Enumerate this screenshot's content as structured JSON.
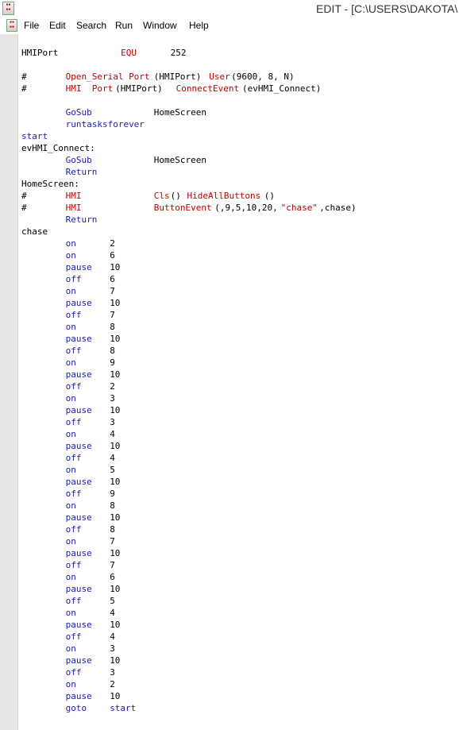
{
  "window": {
    "title": "EDIT - [C:\\USERS\\DAKOTA\\"
  },
  "menu": [
    "File",
    "Edit",
    "Search",
    "Run",
    "Window",
    "Help"
  ],
  "colors": {
    "keyword": "#2020b0",
    "red": "#c00000",
    "plain": "#000000"
  },
  "code_lines": [
    [
      [
        "HMIPort",
        0,
        "plain"
      ],
      [
        "EQU",
        18,
        "red"
      ],
      [
        "252",
        27,
        "plain"
      ]
    ],
    [],
    [
      [
        "#",
        0,
        "plain"
      ],
      [
        "Open_Serial Port",
        8,
        "red"
      ],
      [
        "(HMIPort) ",
        24,
        "plain"
      ],
      [
        "User",
        34,
        "red"
      ],
      [
        "(9600, 8, N)",
        38,
        "plain"
      ]
    ],
    [
      [
        "#",
        0,
        "plain"
      ],
      [
        "HMI  Port",
        8,
        "red"
      ],
      [
        "(HMIPort)  ",
        17,
        "plain"
      ],
      [
        "ConnectEvent",
        28,
        "red"
      ],
      [
        "(evHMI_Connect)",
        40,
        "plain"
      ]
    ],
    [],
    [
      [
        "GoSub",
        8,
        "keyword"
      ],
      [
        "HomeScreen",
        24,
        "plain"
      ]
    ],
    [
      [
        "runtasksforever",
        8,
        "keyword"
      ]
    ],
    [
      [
        "start",
        0,
        "keyword"
      ]
    ],
    [
      [
        "evHMI_Connect:",
        0,
        "plain"
      ]
    ],
    [
      [
        "GoSub",
        8,
        "keyword"
      ],
      [
        "HomeScreen",
        24,
        "plain"
      ]
    ],
    [
      [
        "Return",
        8,
        "keyword"
      ]
    ],
    [
      [
        "HomeScreen:",
        0,
        "plain"
      ]
    ],
    [
      [
        "#",
        0,
        "plain"
      ],
      [
        "HMI",
        8,
        "red"
      ],
      [
        "Cls",
        24,
        "red"
      ],
      [
        "() ",
        27,
        "plain"
      ],
      [
        "HideAllButtons",
        30,
        "red"
      ],
      [
        "()",
        44,
        "plain"
      ]
    ],
    [
      [
        "#",
        0,
        "plain"
      ],
      [
        "HMI",
        8,
        "red"
      ],
      [
        "ButtonEvent",
        24,
        "red"
      ],
      [
        "(,9,5,10,20,",
        35,
        "plain"
      ],
      [
        "\"chase\"",
        47,
        "red"
      ],
      [
        ",chase)",
        54,
        "plain"
      ]
    ],
    [
      [
        "Return",
        8,
        "keyword"
      ]
    ],
    [
      [
        "chase",
        0,
        "plain"
      ]
    ],
    [
      [
        "on",
        8,
        "keyword"
      ],
      [
        "2",
        16,
        "plain"
      ]
    ],
    [
      [
        "on",
        8,
        "keyword"
      ],
      [
        "6",
        16,
        "plain"
      ]
    ],
    [
      [
        "pause",
        8,
        "keyword"
      ],
      [
        "10",
        16,
        "plain"
      ]
    ],
    [
      [
        "off",
        8,
        "keyword"
      ],
      [
        "6",
        16,
        "plain"
      ]
    ],
    [
      [
        "on",
        8,
        "keyword"
      ],
      [
        "7",
        16,
        "plain"
      ]
    ],
    [
      [
        "pause",
        8,
        "keyword"
      ],
      [
        "10",
        16,
        "plain"
      ]
    ],
    [
      [
        "off",
        8,
        "keyword"
      ],
      [
        "7",
        16,
        "plain"
      ]
    ],
    [
      [
        "on",
        8,
        "keyword"
      ],
      [
        "8",
        16,
        "plain"
      ]
    ],
    [
      [
        "pause",
        8,
        "keyword"
      ],
      [
        "10",
        16,
        "plain"
      ]
    ],
    [
      [
        "off",
        8,
        "keyword"
      ],
      [
        "8",
        16,
        "plain"
      ]
    ],
    [
      [
        "on",
        8,
        "keyword"
      ],
      [
        "9",
        16,
        "plain"
      ]
    ],
    [
      [
        "pause",
        8,
        "keyword"
      ],
      [
        "10",
        16,
        "plain"
      ]
    ],
    [
      [
        "off",
        8,
        "keyword"
      ],
      [
        "2",
        16,
        "plain"
      ]
    ],
    [
      [
        "on",
        8,
        "keyword"
      ],
      [
        "3",
        16,
        "plain"
      ]
    ],
    [
      [
        "pause",
        8,
        "keyword"
      ],
      [
        "10",
        16,
        "plain"
      ]
    ],
    [
      [
        "off",
        8,
        "keyword"
      ],
      [
        "3",
        16,
        "plain"
      ]
    ],
    [
      [
        "on",
        8,
        "keyword"
      ],
      [
        "4",
        16,
        "plain"
      ]
    ],
    [
      [
        "pause",
        8,
        "keyword"
      ],
      [
        "10",
        16,
        "plain"
      ]
    ],
    [
      [
        "off",
        8,
        "keyword"
      ],
      [
        "4",
        16,
        "plain"
      ]
    ],
    [
      [
        "on",
        8,
        "keyword"
      ],
      [
        "5",
        16,
        "plain"
      ]
    ],
    [
      [
        "pause",
        8,
        "keyword"
      ],
      [
        "10",
        16,
        "plain"
      ]
    ],
    [
      [
        "off",
        8,
        "keyword"
      ],
      [
        "9",
        16,
        "plain"
      ]
    ],
    [
      [
        "on",
        8,
        "keyword"
      ],
      [
        "8",
        16,
        "plain"
      ]
    ],
    [
      [
        "pause",
        8,
        "keyword"
      ],
      [
        "10",
        16,
        "plain"
      ]
    ],
    [
      [
        "off",
        8,
        "keyword"
      ],
      [
        "8",
        16,
        "plain"
      ]
    ],
    [
      [
        "on",
        8,
        "keyword"
      ],
      [
        "7",
        16,
        "plain"
      ]
    ],
    [
      [
        "pause",
        8,
        "keyword"
      ],
      [
        "10",
        16,
        "plain"
      ]
    ],
    [
      [
        "off",
        8,
        "keyword"
      ],
      [
        "7",
        16,
        "plain"
      ]
    ],
    [
      [
        "on",
        8,
        "keyword"
      ],
      [
        "6",
        16,
        "plain"
      ]
    ],
    [
      [
        "pause",
        8,
        "keyword"
      ],
      [
        "10",
        16,
        "plain"
      ]
    ],
    [
      [
        "off",
        8,
        "keyword"
      ],
      [
        "5",
        16,
        "plain"
      ]
    ],
    [
      [
        "on",
        8,
        "keyword"
      ],
      [
        "4",
        16,
        "plain"
      ]
    ],
    [
      [
        "pause",
        8,
        "keyword"
      ],
      [
        "10",
        16,
        "plain"
      ]
    ],
    [
      [
        "off",
        8,
        "keyword"
      ],
      [
        "4",
        16,
        "plain"
      ]
    ],
    [
      [
        "on",
        8,
        "keyword"
      ],
      [
        "3",
        16,
        "plain"
      ]
    ],
    [
      [
        "pause",
        8,
        "keyword"
      ],
      [
        "10",
        16,
        "plain"
      ]
    ],
    [
      [
        "off",
        8,
        "keyword"
      ],
      [
        "3",
        16,
        "plain"
      ]
    ],
    [
      [
        "on",
        8,
        "keyword"
      ],
      [
        "2",
        16,
        "plain"
      ]
    ],
    [
      [
        "pause",
        8,
        "keyword"
      ],
      [
        "10",
        16,
        "plain"
      ]
    ],
    [
      [
        "goto",
        8,
        "keyword"
      ],
      [
        "start",
        16,
        "keyword"
      ]
    ]
  ]
}
